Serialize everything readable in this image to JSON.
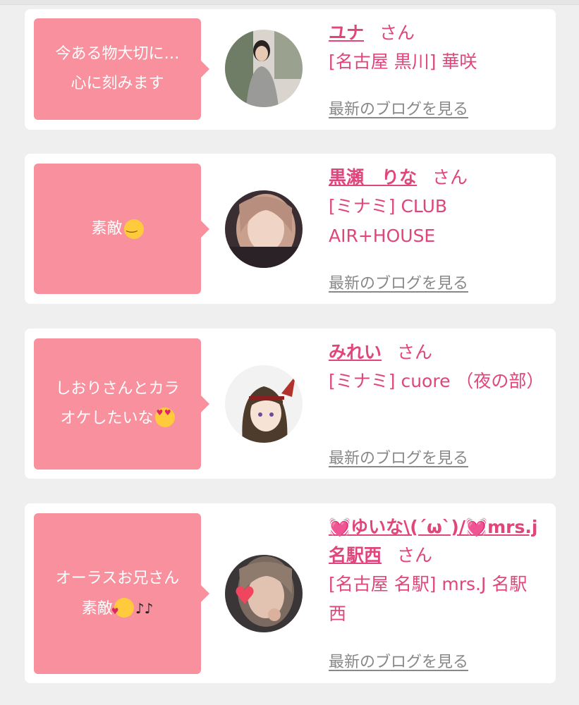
{
  "items": [
    {
      "message": "今ある物大切に…\n心に刻みます",
      "message_emoji": "",
      "name": "ユナ",
      "honorific": "さん",
      "shop": "[名古屋 黒川] 華咲",
      "blog_link": "最新のブログを見る",
      "avatar_colors": [
        "#6e7a62",
        "#c7bcae",
        "#8e9a83"
      ]
    },
    {
      "message": "素敵",
      "message_emoji": "smiling-face-icon",
      "name": "黒瀬　りな",
      "honorific": "さん",
      "shop": "[ミナミ] CLUB AIR+HOUSE",
      "blog_link": "最新のブログを見る",
      "avatar_colors": [
        "#4a3a3f",
        "#e7c3b4",
        "#8a5d55"
      ]
    },
    {
      "message": "しおりさんとカラ\nオケしたいな",
      "message_emoji": "heart-eyes-icon",
      "name": "みれい",
      "honorific": "さん",
      "shop": "[ミナミ] cuore （夜の部）",
      "blog_link": "最新のブログを見る",
      "avatar_colors": [
        "#f3f3f3",
        "#5a4836",
        "#b53a32"
      ]
    },
    {
      "message": "オーラスお兄さん\n素敵",
      "message_emoji": "party-face-icon",
      "message_suffix": "♪♪",
      "name": "💓ゆいな\\(´ω`)/💓mrs.j名駅西",
      "honorific": "さん",
      "shop": "[名古屋 名駅] mrs.J 名駅西",
      "blog_link": "最新のブログを見る",
      "avatar_colors": [
        "#3e3a3a",
        "#d8b7a5",
        "#f0455f"
      ]
    }
  ]
}
